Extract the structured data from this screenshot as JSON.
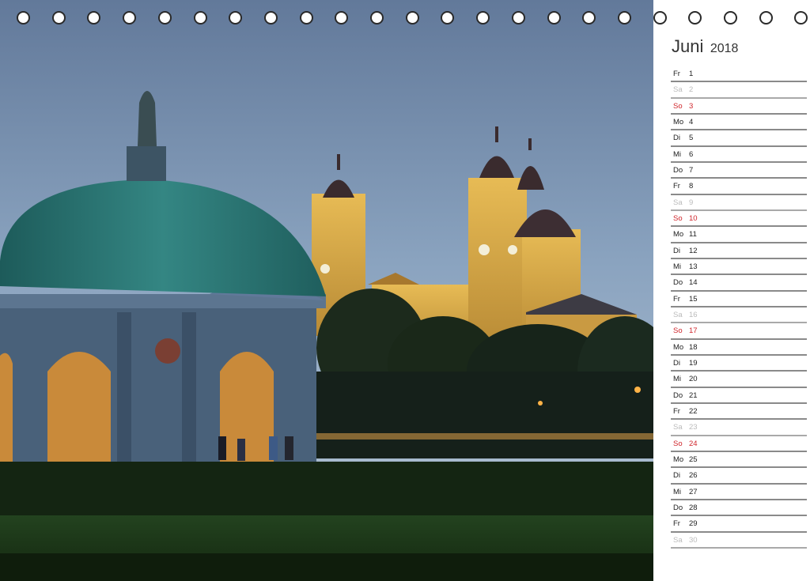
{
  "calendar": {
    "month": "Juni",
    "year": "2018",
    "days": [
      {
        "wd": "Fr",
        "d": "1",
        "type": "weekday"
      },
      {
        "wd": "Sa",
        "d": "2",
        "type": "sat"
      },
      {
        "wd": "So",
        "d": "3",
        "type": "sun"
      },
      {
        "wd": "Mo",
        "d": "4",
        "type": "weekday"
      },
      {
        "wd": "Di",
        "d": "5",
        "type": "weekday"
      },
      {
        "wd": "Mi",
        "d": "6",
        "type": "weekday"
      },
      {
        "wd": "Do",
        "d": "7",
        "type": "weekday"
      },
      {
        "wd": "Fr",
        "d": "8",
        "type": "weekday"
      },
      {
        "wd": "Sa",
        "d": "9",
        "type": "sat"
      },
      {
        "wd": "So",
        "d": "10",
        "type": "sun"
      },
      {
        "wd": "Mo",
        "d": "11",
        "type": "weekday"
      },
      {
        "wd": "Di",
        "d": "12",
        "type": "weekday"
      },
      {
        "wd": "Mi",
        "d": "13",
        "type": "weekday"
      },
      {
        "wd": "Do",
        "d": "14",
        "type": "weekday"
      },
      {
        "wd": "Fr",
        "d": "15",
        "type": "weekday"
      },
      {
        "wd": "Sa",
        "d": "16",
        "type": "sat"
      },
      {
        "wd": "So",
        "d": "17",
        "type": "sun"
      },
      {
        "wd": "Mo",
        "d": "18",
        "type": "weekday"
      },
      {
        "wd": "Di",
        "d": "19",
        "type": "weekday"
      },
      {
        "wd": "Mi",
        "d": "20",
        "type": "weekday"
      },
      {
        "wd": "Do",
        "d": "21",
        "type": "weekday"
      },
      {
        "wd": "Fr",
        "d": "22",
        "type": "weekday"
      },
      {
        "wd": "Sa",
        "d": "23",
        "type": "sat"
      },
      {
        "wd": "So",
        "d": "24",
        "type": "sun"
      },
      {
        "wd": "Mo",
        "d": "25",
        "type": "weekday"
      },
      {
        "wd": "Di",
        "d": "26",
        "type": "weekday"
      },
      {
        "wd": "Mi",
        "d": "27",
        "type": "weekday"
      },
      {
        "wd": "Do",
        "d": "28",
        "type": "weekday"
      },
      {
        "wd": "Fr",
        "d": "29",
        "type": "weekday"
      },
      {
        "wd": "Sa",
        "d": "30",
        "type": "sat"
      }
    ]
  },
  "colors": {
    "sunday": "#d0262c",
    "saturday": "#bbbbbb",
    "text": "#222222",
    "sky": "#6f8aa8",
    "dome": "#2f7a78",
    "church": "#d9a844",
    "lawn": "#1e3a1a"
  },
  "binding": {
    "ring_count": 23,
    "ring_icon": "binding-ring-icon"
  },
  "photo": {
    "subject_icon": "landscape-photo"
  }
}
